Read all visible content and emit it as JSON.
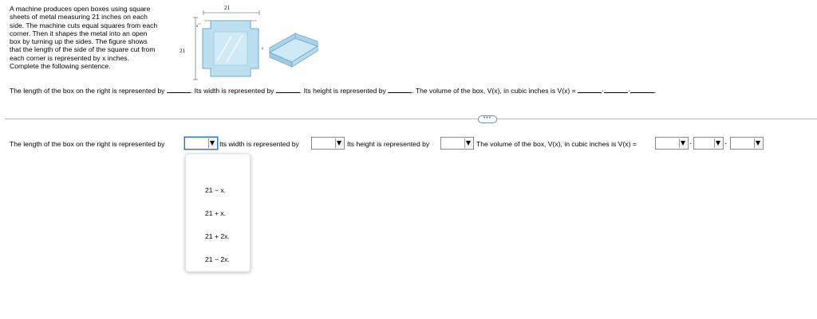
{
  "problem": {
    "lines": [
      "A machine produces open boxes using square",
      "sheets of metal measuring 21 inches on each",
      "side. The machine cuts equal squares from each",
      "corner. Then it shapes the metal into an open",
      "box by turning up the sides. The figure shows",
      "that the length of the side of the square cut from",
      "each corner is represented by x inches.",
      "Complete the following sentence."
    ]
  },
  "figure": {
    "side_label_top": "21",
    "side_label_left": "21",
    "corner_label": "x",
    "box_label": "x"
  },
  "question_line": {
    "part1": "The length of the box on the right is represented by",
    "part2": ". Its width is represented by",
    "part3": ". Its height is represented by",
    "part4": ". The volume of the box, V(x), in cubic inches is V(x) =",
    "sep": "·",
    "end": "."
  },
  "more_button": "•••",
  "answer_row": {
    "length_label": "The length of the box on the right is represented by",
    "width_label": "Its width is represented by",
    "height_label": "Its height is represented by",
    "volume_label": "The volume of the box, V(x), in cubic inches is V(x) =",
    "sep": "·"
  },
  "dropdown_options": [
    "21 − x.",
    "21 + x.",
    "21 + 2x.",
    "21 − 2x."
  ],
  "colors": {
    "accent": "#2b6fd0",
    "sheet": "#bcdff0",
    "sheet_edge": "#6fa9cc"
  }
}
